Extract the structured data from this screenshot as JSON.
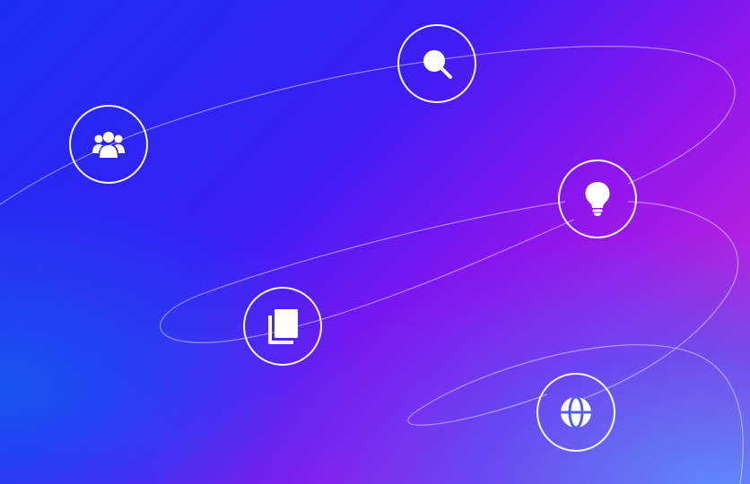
{
  "scene": {
    "colors": {
      "gradient_start": "#1a2ff0",
      "gradient_mid": "#8a16ee",
      "gradient_end": "#e22bd0",
      "glow": "#4696ff",
      "icon": "#ffffff"
    },
    "badges": [
      {
        "icon": "people-group-icon"
      },
      {
        "icon": "search-icon"
      },
      {
        "icon": "lightbulb-icon"
      },
      {
        "icon": "documents-icon"
      },
      {
        "icon": "globe-icon"
      }
    ]
  }
}
